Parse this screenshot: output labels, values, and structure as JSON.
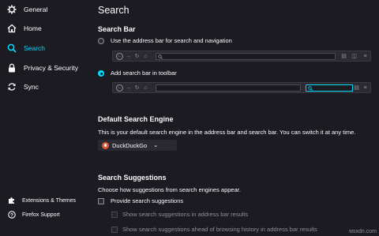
{
  "sidebar": {
    "items": [
      {
        "label": "General",
        "icon": "gear-icon"
      },
      {
        "label": "Home",
        "icon": "home-icon"
      },
      {
        "label": "Search",
        "icon": "search-icon"
      },
      {
        "label": "Privacy & Security",
        "icon": "lock-icon"
      },
      {
        "label": "Sync",
        "icon": "sync-icon"
      }
    ],
    "footer": [
      {
        "label": "Extensions & Themes",
        "icon": "puzzle-icon"
      },
      {
        "label": "Firefox Support",
        "icon": "help-icon"
      }
    ],
    "active_color": "#00ddff"
  },
  "main": {
    "title": "Search",
    "search_bar": {
      "heading": "Search Bar",
      "option_address": "Use the address bar for search and navigation",
      "option_toolbar": "Add search bar in toolbar",
      "selected": "toolbar"
    },
    "default_engine": {
      "heading": "Default Search Engine",
      "description": "This is your default search engine in the address bar and search bar. You can switch it at any time.",
      "selected": "DuckDuckGo"
    },
    "suggestions": {
      "heading": "Search Suggestions",
      "description": "Choose how suggestions from search engines appear.",
      "provide": "Provide search suggestions",
      "in_address_bar": "Show search suggestions in address bar results",
      "ahead_of_history": "Show search suggestions ahead of browsing history in address bar results"
    }
  },
  "watermark": "wsxdn.com"
}
